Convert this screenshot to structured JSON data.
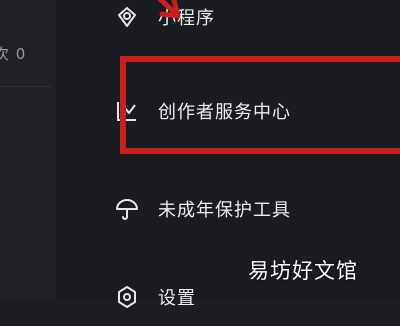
{
  "left_pane": {
    "count_text": "次 0"
  },
  "menu": {
    "items": [
      {
        "label": "小程序",
        "icon": "mini-program-icon"
      },
      {
        "label": "创作者服务中心",
        "icon": "chart-trend-icon"
      },
      {
        "label": "未成年保护工具",
        "icon": "umbrella-icon"
      },
      {
        "label": "设置",
        "icon": "settings-gear-icon"
      }
    ]
  },
  "annotations": {
    "highlight_color": "#c8201c",
    "arrow_color": "#c8201c"
  },
  "watermark": {
    "text": "易坊好文馆"
  }
}
